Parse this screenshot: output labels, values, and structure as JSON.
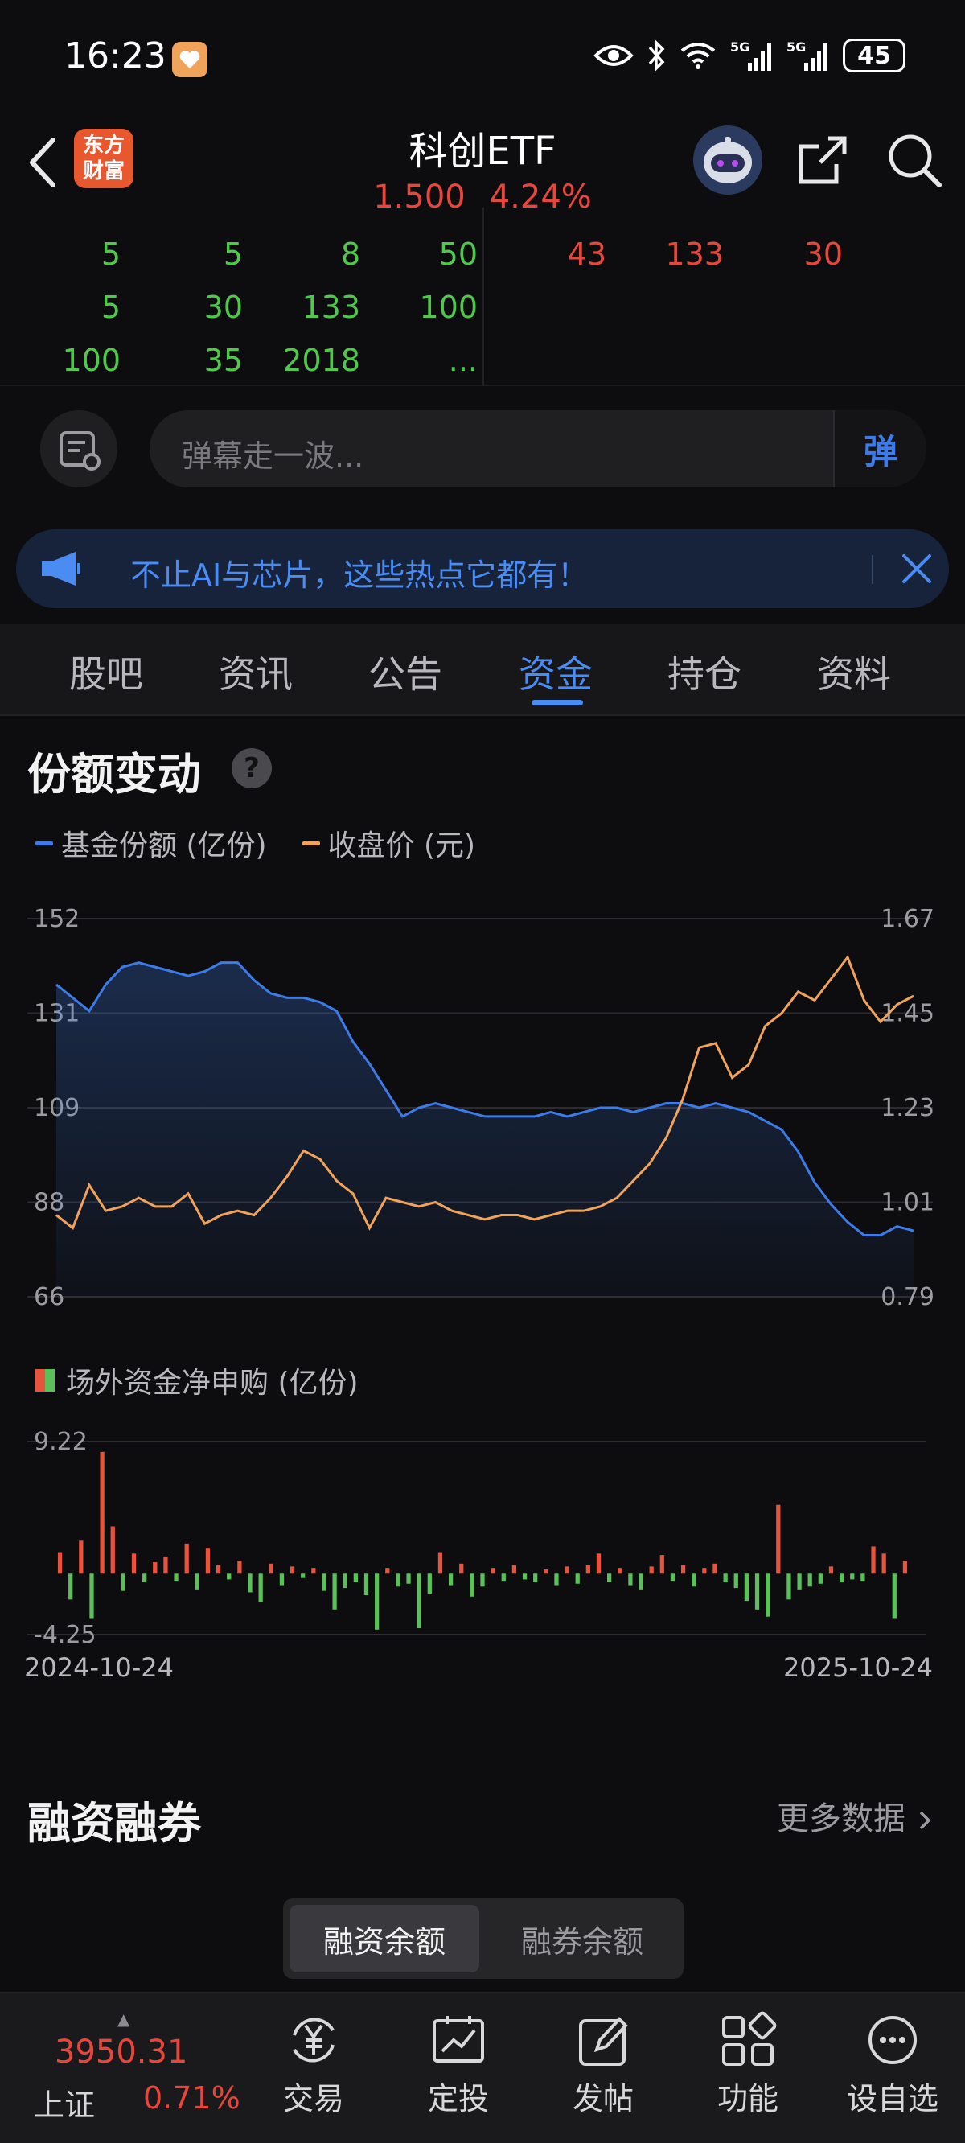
{
  "status_bar": {
    "time": "16:23",
    "icons": [
      "eye-icon",
      "bluetooth-icon",
      "wifi-icon",
      "signal-5g-icon",
      "signal-5g-icon"
    ],
    "battery": "45"
  },
  "header": {
    "title": "科创ETF",
    "price": "1.500",
    "change_pct": "4.24%",
    "logo_line1": "东方",
    "logo_line2": "财富"
  },
  "order_book": {
    "left_rows": [
      [
        "5",
        "5",
        "8",
        "50"
      ],
      [
        "5",
        "30",
        "133",
        "100"
      ],
      [
        "100",
        "35",
        "2018",
        "..."
      ]
    ],
    "right_row": [
      "43",
      "133",
      "30"
    ]
  },
  "danmu": {
    "placeholder": "弹幕走一波...",
    "toggle_label": "弹"
  },
  "banner": {
    "text": "不止AI与芯片，这些热点它都有！"
  },
  "tabs": [
    {
      "label": "股吧",
      "active": false
    },
    {
      "label": "资讯",
      "active": false
    },
    {
      "label": "公告",
      "active": false
    },
    {
      "label": "资金",
      "active": true
    },
    {
      "label": "持仓",
      "active": false
    },
    {
      "label": "资料",
      "active": false
    }
  ],
  "share_section": {
    "title": "份额变动",
    "help": "?"
  },
  "colors": {
    "share_line": "#3d7be8",
    "price_line": "#f0a35b",
    "inflow": "#e8533b",
    "outflow": "#5bbf5a",
    "accent": "#4b8cf2",
    "up": "#e8463b"
  },
  "chart_data": [
    {
      "type": "line",
      "legend": [
        "基金份额 (亿份)",
        "收盘价 (元)"
      ],
      "left_axis": {
        "ticks": [
          "152",
          "131",
          "109",
          "88",
          "66"
        ],
        "range": [
          66,
          152
        ]
      },
      "right_axis": {
        "ticks": [
          "1.67",
          "1.45",
          "1.23",
          "1.01",
          "0.79"
        ],
        "range": [
          0.79,
          1.67
        ]
      },
      "x_start": "2024-10-24",
      "x_end": "2025-10-24",
      "series": [
        {
          "name": "基金份额 (亿份)",
          "axis": "left",
          "values": [
            137,
            134,
            131,
            137,
            141,
            142,
            141,
            140,
            139,
            140,
            142,
            142,
            138,
            135,
            134,
            134,
            133,
            131,
            124,
            119,
            113,
            107,
            109,
            110,
            109,
            108,
            107,
            107,
            107,
            107,
            108,
            107,
            108,
            109,
            109,
            108,
            109,
            110,
            110,
            109,
            110,
            109,
            108,
            106,
            104,
            99,
            92,
            87,
            83,
            80,
            80,
            82,
            81
          ]
        },
        {
          "name": "收盘价 (元)",
          "axis": "right",
          "values": [
            0.98,
            0.95,
            1.05,
            0.99,
            1.0,
            1.02,
            1.0,
            1.0,
            1.03,
            0.96,
            0.98,
            0.99,
            0.98,
            1.02,
            1.07,
            1.13,
            1.11,
            1.06,
            1.03,
            0.95,
            1.02,
            1.01,
            1.0,
            1.01,
            0.99,
            0.98,
            0.97,
            0.98,
            0.98,
            0.97,
            0.98,
            0.99,
            0.99,
            1.0,
            1.02,
            1.06,
            1.1,
            1.16,
            1.25,
            1.37,
            1.38,
            1.3,
            1.33,
            1.42,
            1.45,
            1.5,
            1.48,
            1.53,
            1.58,
            1.48,
            1.43,
            1.47,
            1.49
          ]
        }
      ]
    },
    {
      "type": "bar",
      "title": "场外资金净申购 (亿份)",
      "y_ticks": [
        "9.22",
        "-4.25"
      ],
      "ylim": [
        -4.25,
        9.22
      ],
      "x_start": "2024-10-24",
      "x_end": "2025-10-24",
      "values": [
        1.5,
        -1.8,
        2.3,
        -3.1,
        8.5,
        3.3,
        -1.2,
        1.4,
        -0.6,
        0.8,
        1.2,
        -0.5,
        2.1,
        -1.1,
        1.8,
        0.6,
        -0.4,
        0.9,
        -1.3,
        -2.0,
        0.7,
        -0.8,
        0.5,
        -0.3,
        0.4,
        -1.2,
        -2.5,
        -1.0,
        -0.6,
        -1.5,
        -3.9,
        0.4,
        -0.9,
        -0.7,
        -3.8,
        -1.4,
        1.5,
        -0.8,
        0.7,
        -1.6,
        -0.9,
        0.4,
        -0.5,
        0.6,
        -0.4,
        -0.6,
        0.3,
        -0.8,
        0.5,
        -0.7,
        0.6,
        1.4,
        -0.6,
        0.4,
        -0.8,
        -1.1,
        0.5,
        1.3,
        -0.5,
        0.6,
        -0.9,
        0.4,
        0.7,
        -0.6,
        -1.0,
        -1.9,
        -2.5,
        -3.0,
        4.8,
        -1.8,
        -1.1,
        -0.9,
        -0.7,
        0.5,
        -0.6,
        -0.4,
        -0.5,
        1.9,
        1.4,
        -3.1,
        0.9
      ]
    }
  ],
  "flow_section": {
    "legend": "场外资金净申购 (亿份)",
    "date_start": "2024-10-24",
    "date_end": "2025-10-24"
  },
  "margin_section": {
    "title": "融资融券",
    "more_link": "更多数据",
    "segments": [
      {
        "label": "融资余额",
        "active": true
      },
      {
        "label": "融券余额",
        "active": false
      }
    ]
  },
  "bottom_nav": {
    "index_value": "3950.31",
    "index_name": "上证",
    "index_change": "0.71%",
    "items": [
      {
        "label": "交易",
        "icon": "yen-cycle-icon"
      },
      {
        "label": "定投",
        "icon": "chart-frame-icon"
      },
      {
        "label": "发帖",
        "icon": "edit-icon"
      },
      {
        "label": "功能",
        "icon": "grid-icon"
      },
      {
        "label": "设自选",
        "icon": "more-dots-icon"
      }
    ]
  }
}
